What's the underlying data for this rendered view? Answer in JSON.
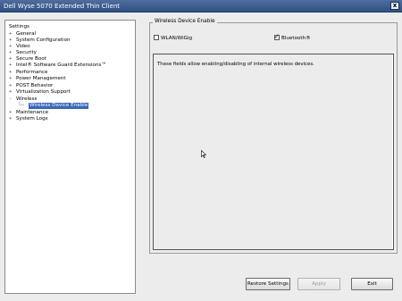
{
  "window": {
    "title": "Dell Wyse 5070 Extended Thin Client",
    "close_label": "x"
  },
  "tree": {
    "root_label": "Settings",
    "items": [
      {
        "expander": "+",
        "label": "General"
      },
      {
        "expander": "+",
        "label": "System Configuration"
      },
      {
        "expander": "+",
        "label": "Video"
      },
      {
        "expander": "+",
        "label": "Security"
      },
      {
        "expander": "+",
        "label": "Secure Boot"
      },
      {
        "expander": "+",
        "label": "Intel® Software Guard Extensions™"
      },
      {
        "expander": "+",
        "label": "Performance"
      },
      {
        "expander": "+",
        "label": "Power Management"
      },
      {
        "expander": "+",
        "label": "POST Behavior"
      },
      {
        "expander": "+",
        "label": "Virtualization Support"
      },
      {
        "expander": "-",
        "label": "Wireless"
      }
    ],
    "selected_child": "Wireless Device Enable",
    "items_after": [
      {
        "expander": "+",
        "label": "Maintenance"
      },
      {
        "expander": "+",
        "label": "System Logs"
      }
    ]
  },
  "panel": {
    "group_title": "Wireless Device Enable",
    "options": [
      {
        "label": "WLAN/WiGig",
        "checked": false
      },
      {
        "label": "Bluetooth®",
        "checked": true
      }
    ],
    "description": "These fields allow enabling/disabling of internal wireless devices."
  },
  "buttons": {
    "restore": "Restore Settings",
    "apply": "Apply",
    "exit": "Exit"
  }
}
